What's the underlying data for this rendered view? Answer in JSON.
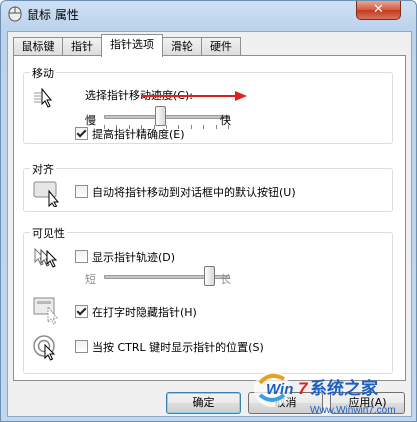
{
  "window": {
    "title": "鼠标 属性",
    "close_glyph": "✕"
  },
  "tabs": [
    {
      "label": "鼠标键"
    },
    {
      "label": "指针"
    },
    {
      "label": "指针选项"
    },
    {
      "label": "滑轮"
    },
    {
      "label": "硬件"
    }
  ],
  "motion": {
    "title": "移动",
    "speed_label": "选择指针移动速度(C):",
    "slow": "慢",
    "fast": "快",
    "speed_value": 0.45,
    "precision_label": "提高指针精确度(E)",
    "precision_checked": true
  },
  "snap": {
    "title": "对齐",
    "label": "自动将指针移动到对话框中的默认按钮(U)",
    "checked": false
  },
  "visibility": {
    "title": "可见性",
    "trails_label": "显示指针轨迹(D)",
    "trails_checked": false,
    "short": "短",
    "long": "长",
    "trails_value": 0.85,
    "hide_label": "在打字时隐藏指针(H)",
    "hide_checked": true,
    "ctrl_label": "当按 CTRL 键时显示指针的位置(S)",
    "ctrl_checked": false
  },
  "buttons": {
    "ok": "确定",
    "cancel": "取消",
    "apply": "应用(A)"
  },
  "watermark": {
    "brand_win": "Win",
    "brand_7": "7",
    "brand_cn": "系统之家",
    "url": "Www.Winwin7.com"
  },
  "colors": {
    "arrow": "#e02020",
    "brand_blue": "#1d5fbf",
    "brand_red": "#e02020"
  }
}
